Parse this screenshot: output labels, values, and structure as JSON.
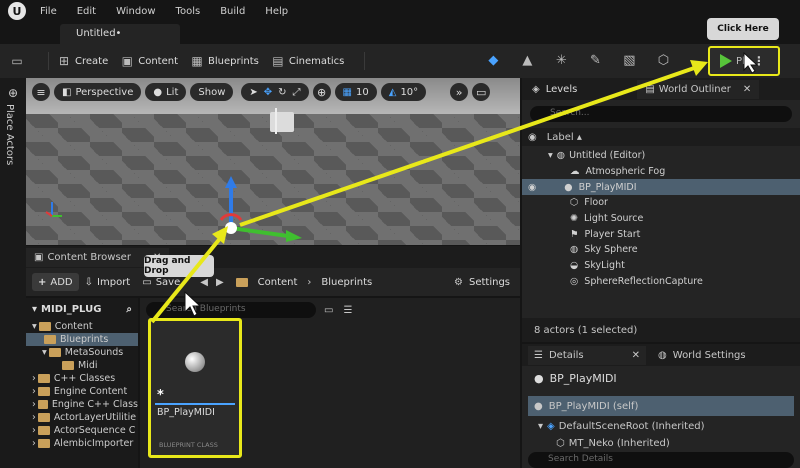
{
  "menubar": {
    "items": [
      "File",
      "Edit",
      "Window",
      "Tools",
      "Build",
      "Help"
    ]
  },
  "document_tab": "Untitled•",
  "toolbar": {
    "save_icon": "save-icon",
    "buttons": [
      {
        "label": "Create",
        "icon": "create-icon"
      },
      {
        "label": "Content",
        "icon": "content-icon"
      },
      {
        "label": "Blueprints",
        "icon": "blueprints-icon"
      },
      {
        "label": "Cinematics",
        "icon": "cinematics-icon"
      }
    ],
    "play_label": "Pl",
    "play_color": "#57c43a"
  },
  "callouts": {
    "click_here": "Click Here",
    "drag_drop": "Drag and Drop"
  },
  "side_rail": {
    "label": "Place Actors"
  },
  "viewport": {
    "perspective": "Perspective",
    "lit": "Lit",
    "show": "Show",
    "grid_value": "10",
    "angle_value": "10°"
  },
  "outliner": {
    "tabs": [
      "Levels",
      "World Outliner"
    ],
    "search_placeholder": "Search...",
    "column_label": "Label ▴",
    "rows": [
      {
        "label": "Untitled (Editor)",
        "level": 1
      },
      {
        "label": "Atmospheric Fog",
        "level": 2
      },
      {
        "label": "BP_PlayMIDI",
        "level": 2,
        "selected": true
      },
      {
        "label": "Floor",
        "level": 2
      },
      {
        "label": "Light Source",
        "level": 2
      },
      {
        "label": "Player Start",
        "level": 2
      },
      {
        "label": "Sky Sphere",
        "level": 2
      },
      {
        "label": "SkyLight",
        "level": 2
      },
      {
        "label": "SphereReflectionCapture",
        "level": 2
      }
    ],
    "status": "8 actors (1 selected)"
  },
  "details": {
    "tabs": [
      "Details",
      "World Settings"
    ],
    "object_name": "BP_PlayMIDI",
    "self_row": "BP_PlayMIDI (self)",
    "component_rows": [
      "DefaultSceneRoot (Inherited)",
      "MT_Neko (Inherited)"
    ],
    "search_placeholder": "Search Details"
  },
  "content_browser": {
    "tab_label": "Content Browser",
    "add_label": "ADD",
    "import_label": "Import",
    "save_label": "Save",
    "breadcrumb": [
      "Content",
      "Blueprints"
    ],
    "settings_label": "Settings",
    "search_placeholder": "Search Blueprints",
    "root_label": "MIDI_PLUG",
    "tree": [
      {
        "label": "Content",
        "level": 1
      },
      {
        "label": "Blueprints",
        "level": 2,
        "selected": true
      },
      {
        "label": "MetaSounds",
        "level": 2
      },
      {
        "label": "Midi",
        "level": 3
      },
      {
        "label": "C++ Classes",
        "level": 1
      },
      {
        "label": "Engine Content",
        "level": 1
      },
      {
        "label": "Engine C++ Class",
        "level": 1
      },
      {
        "label": "ActorLayerUtilitie",
        "level": 1
      },
      {
        "label": "ActorSequence C",
        "level": 1
      },
      {
        "label": "AlembicImporter",
        "level": 1
      }
    ],
    "asset": {
      "name": "BP_PlayMIDI",
      "type": "BLUEPRINT CLASS",
      "star": "*"
    }
  }
}
